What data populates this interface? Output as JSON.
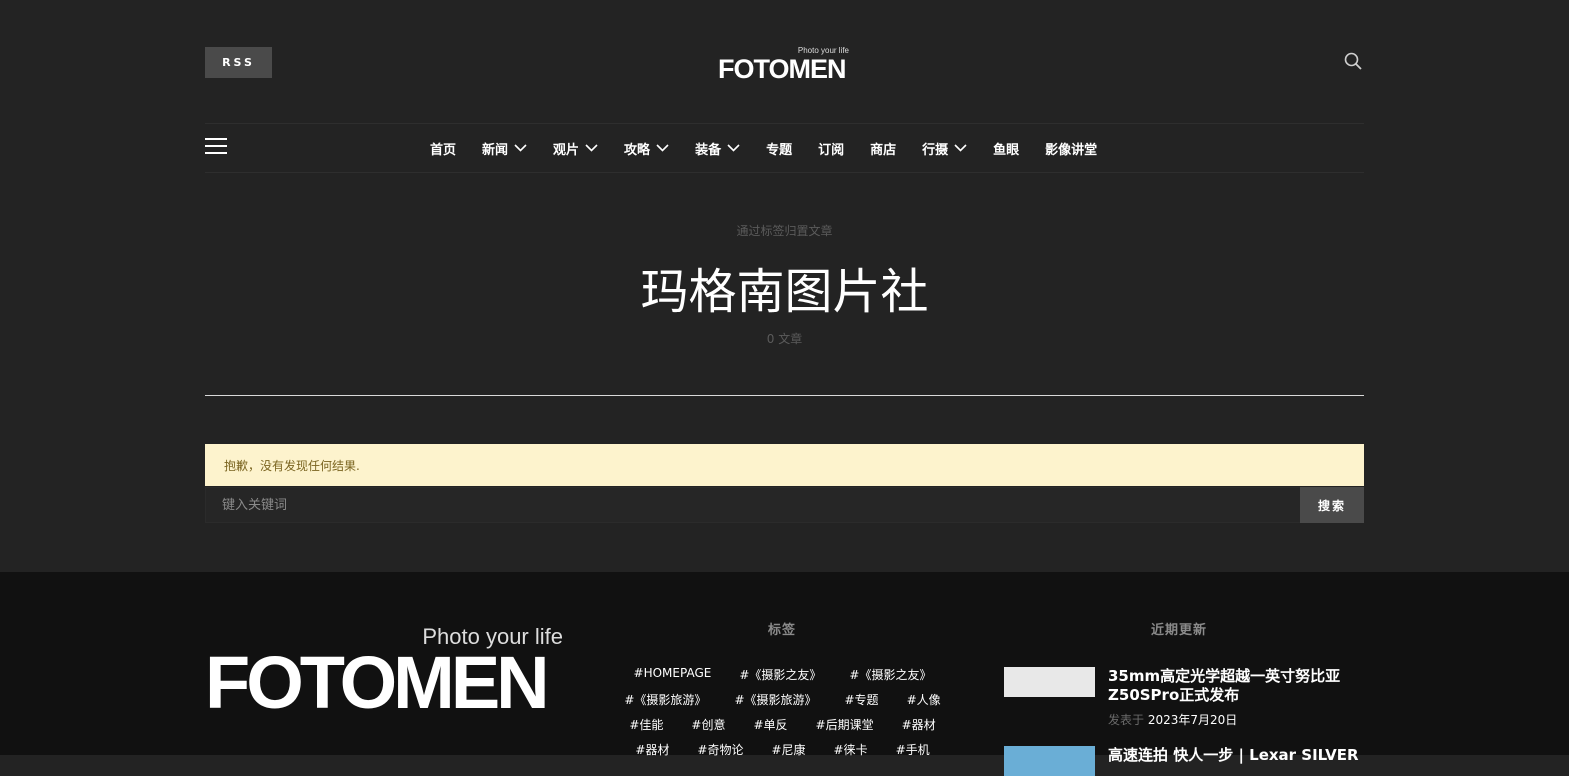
{
  "header": {
    "rss_label": "RSS",
    "logo_tagline": "Photo your life",
    "logo_word": "FOTOMEN"
  },
  "nav": {
    "items": [
      {
        "label": "首页",
        "dropdown": false
      },
      {
        "label": "新闻",
        "dropdown": true
      },
      {
        "label": "观片",
        "dropdown": true
      },
      {
        "label": "攻略",
        "dropdown": true
      },
      {
        "label": "装备",
        "dropdown": true
      },
      {
        "label": "专题",
        "dropdown": false
      },
      {
        "label": "订阅",
        "dropdown": false
      },
      {
        "label": "商店",
        "dropdown": false
      },
      {
        "label": "行摄",
        "dropdown": true
      },
      {
        "label": "鱼眼",
        "dropdown": false
      },
      {
        "label": "影像讲堂",
        "dropdown": false
      }
    ]
  },
  "hero": {
    "subtitle": "通过标签归置文章",
    "title": "玛格南图片社",
    "count": "0 文章"
  },
  "notice": {
    "text": "抱歉，没有发现任何结果."
  },
  "search": {
    "placeholder": "键入关键词",
    "button_label": "搜索"
  },
  "footer": {
    "logo_tagline": "Photo your life",
    "logo_word": "FOTOMEN",
    "tags_title": "标签",
    "tags_rows": [
      [
        "#HOMEPAGE",
        "#《摄影之友》",
        "#《摄影之友》"
      ],
      [
        "#《摄影旅游》",
        "#《摄影旅游》",
        "#专题",
        "#人像"
      ],
      [
        "#佳能",
        "#创意",
        "#单反",
        "#后期课堂",
        "#器材"
      ],
      [
        "#器材",
        "#奇物论",
        "#尼康",
        "#徕卡",
        "#手机"
      ]
    ],
    "recent_title": "近期更新",
    "posts": [
      {
        "title": "35mm高定光学超越一英寸努比亚Z50SPro正式发布",
        "meta_prefix": "发表于",
        "date": "2023年7月20日"
      },
      {
        "title": "高速连拍 快人一步 | Lexar SILVER",
        "meta_prefix": "",
        "date": ""
      }
    ]
  }
}
